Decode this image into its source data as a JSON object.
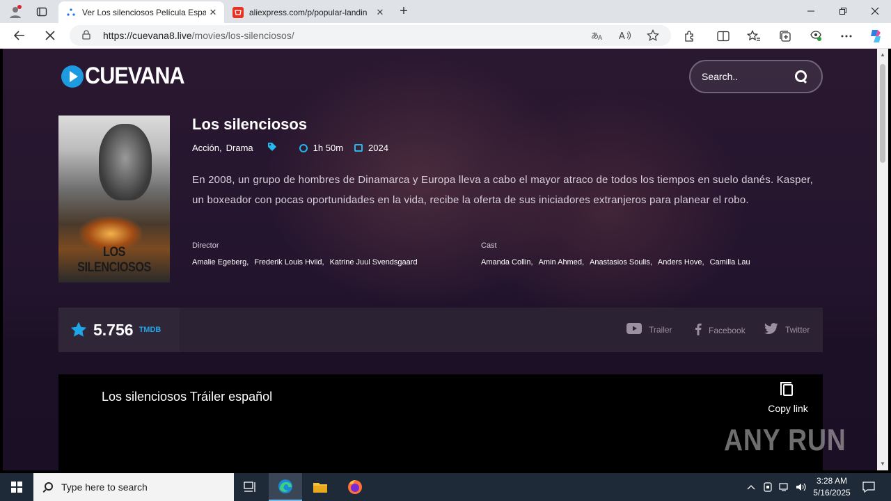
{
  "browser": {
    "tabs": [
      {
        "title": "Ver Los silenciosos Película Espa",
        "close": "✕"
      },
      {
        "title": "aliexpress.com/p/popular-landin",
        "close": "✕"
      }
    ],
    "new_tab": "+",
    "url_host": "https://cuevana8.live",
    "url_path": "/movies/los-silenciosos/"
  },
  "site": {
    "logo_text": "CUEVANA",
    "search_placeholder": "Search.."
  },
  "movie": {
    "poster_title": "LOS SILENCIOSOS",
    "title": "Los silenciosos",
    "genres": [
      "Acción",
      "Drama"
    ],
    "genre_separator": ",",
    "duration": "1h 50m",
    "year": "2024",
    "synopsis": "En 2008, un grupo de hombres de Dinamarca y Europa lleva a cabo el mayor atraco de todos los tiempos en suelo danés. Kasper, un boxeador con pocas oportunidades en la vida, recibe la oferta de sus iniciadores extranjeros para planear el robo.",
    "director_label": "Director",
    "directors": [
      "Amalie Egeberg,",
      "Frederik Louis Hviid,",
      "Katrine Juul Svendsgaard"
    ],
    "cast_label": "Cast",
    "cast": [
      "Amanda Collin,",
      "Amin Ahmed,",
      "Anastasios Soulis,",
      "Anders Hove,",
      "Camilla Lau"
    ]
  },
  "rating": {
    "score": "5.756",
    "source": "TMDB",
    "star_color": "#1ea7e6"
  },
  "share": {
    "trailer": "Trailer",
    "facebook": "Facebook",
    "twitter": "Twitter"
  },
  "video": {
    "title": "Los silenciosos Tráiler español",
    "copy_link": "Copy link"
  },
  "watermark": "ANY RUN",
  "taskbar": {
    "search_placeholder": "Type here to search",
    "time": "3:28 AM",
    "date": "5/16/2025"
  }
}
